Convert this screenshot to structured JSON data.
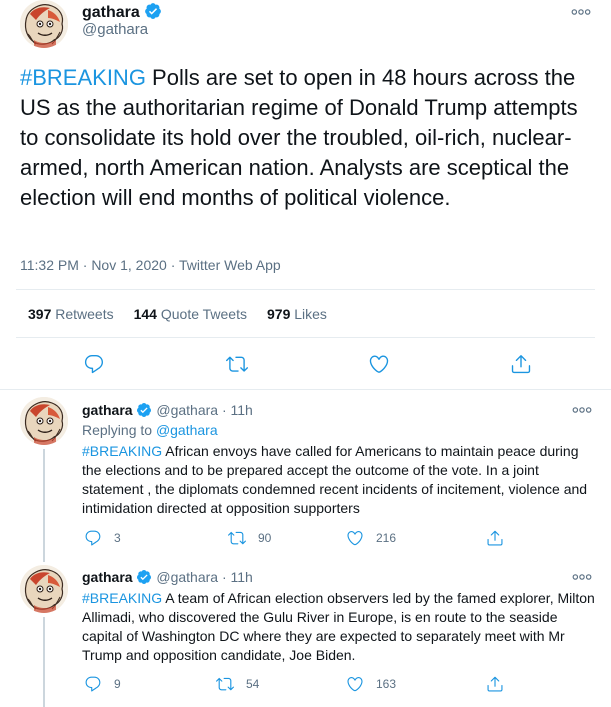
{
  "main_tweet": {
    "display_name": "gathara",
    "handle": "@gathara",
    "hashtag": "#BREAKING",
    "text": " Polls are set to open in 48 hours across the US as the authoritarian regime of Donald Trump attempts to consolidate its hold over the troubled, oil-rich, nuclear-armed, north American nation. Analysts are sceptical the election will end months of political violence.",
    "timestamp": "11:32 PM · Nov 1, 2020 · Twitter Web App",
    "retweets_count": "397",
    "retweets_label": "Retweets",
    "quote_count": "144",
    "quote_label": "Quote Tweets",
    "likes_count": "979",
    "likes_label": "Likes"
  },
  "replies": [
    {
      "display_name": "gathara",
      "handle": "@gathara",
      "time": "· 11h",
      "replying_prefix": "Replying to ",
      "replying_to": "@gathara",
      "hashtag": "#BREAKING",
      "text": " African envoys have called for Americans to maintain peace during the elections and to be prepared accept the outcome of the vote. In a joint statement , the diplomats condemned recent incidents of incitement, violence and intimidation directed at opposition supporters",
      "reply_count": "3",
      "retweet_count": "90",
      "like_count": "216"
    },
    {
      "display_name": "gathara",
      "handle": "@gathara",
      "time": "· 11h",
      "hashtag": "#BREAKING",
      "text": " A team of African election observers led by the famed explorer, Milton Allimadi, who discovered the Gulu River in Europe, is en route to the seaside capital of Washington DC where they are expected to separately meet with Mr Trump and opposition candidate, Joe Biden.",
      "reply_count": "9",
      "retweet_count": "54",
      "like_count": "163"
    }
  ],
  "colors": {
    "link": "#1b95e0",
    "icon": "#1b95e0",
    "secondary_text": "#5b7083",
    "verified": "#1da1f2"
  },
  "icons": [
    "avatar-illustration",
    "verified-badge-icon",
    "more-icon",
    "reply-icon",
    "retweet-icon",
    "like-icon",
    "share-icon"
  ]
}
